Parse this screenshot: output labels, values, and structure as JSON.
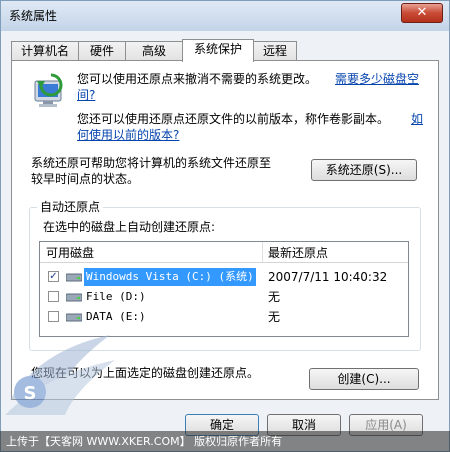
{
  "window": {
    "title": "系统属性",
    "close_label": "✕"
  },
  "tabs": [
    {
      "label": "计算机名"
    },
    {
      "label": "硬件"
    },
    {
      "label": "高级"
    },
    {
      "label": "系统保护",
      "active": true
    },
    {
      "label": "远程"
    }
  ],
  "intro": {
    "line1": "您可以使用还原点来撤消不需要的系统更改。",
    "link1_a": "需要多少磁盘空",
    "link1_b": "间?",
    "line2": "您还可以使用还原点还原文件的以前版本，称作卷影副本。",
    "link2_a": "如",
    "link2_b": "何使用以前的版本?"
  },
  "restore": {
    "desc_line1": "系统还原可帮助您将计算机的系统文件还原至",
    "desc_line2": "较早时间点的状态。",
    "button": "系统还原(S)..."
  },
  "auto_restore": {
    "group_label": "自动还原点",
    "subtitle": "在选中的磁盘上自动创建还原点:",
    "col_disk": "可用磁盘",
    "col_latest": "最新还原点",
    "rows": [
      {
        "name": "Windowds Vista (C:) (系统)",
        "latest": "2007/7/11 10:40:32",
        "checked": true
      },
      {
        "name": "File (D:)",
        "latest": "无",
        "checked": false
      },
      {
        "name": "DATA (E:)",
        "latest": "无",
        "checked": false
      }
    ]
  },
  "create": {
    "desc": "您现在可以为上面选定的磁盘创建还原点。",
    "button": "创建(C)..."
  },
  "footer": {
    "ok": "确定",
    "cancel": "取消",
    "apply": "应用(A)"
  },
  "banner": {
    "text": "上传于【天客网 WWW.XKER.COM】 版权归原作者所有"
  },
  "watermark": {
    "text": "S"
  }
}
